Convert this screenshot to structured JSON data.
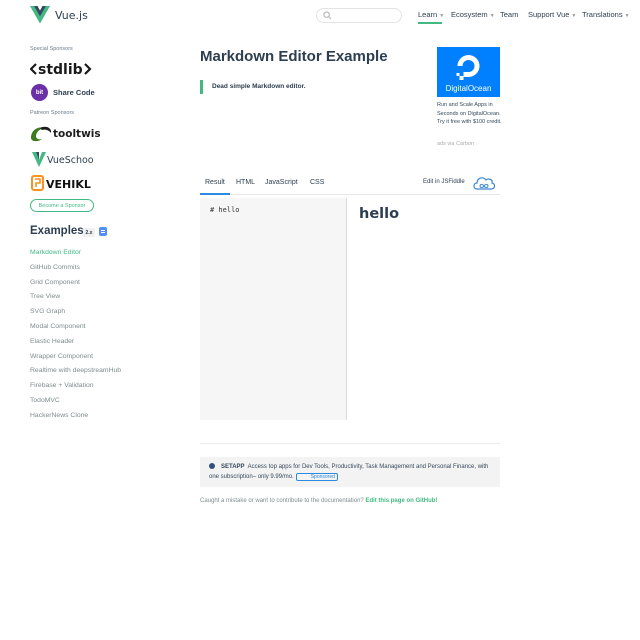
{
  "header": {
    "logo_text": "Vue.js",
    "search_placeholder": "",
    "nav": {
      "learn": "Learn",
      "ecosystem": "Ecosystem",
      "team": "Team",
      "support": "Support Vue",
      "translations": "Translations"
    }
  },
  "sidebar": {
    "special_sponsors_label": "Special Sponsors",
    "patreon_sponsors_label": "Patreon Sponsors",
    "sponsors": {
      "bit_badge": "bit",
      "share_code": "Share Code"
    },
    "become_sponsor": "Become a Sponsor",
    "examples_title": "Examples",
    "version_badge": "2.x",
    "examples": [
      "Markdown Editor",
      "GitHub Commits",
      "Grid Component",
      "Tree View",
      "SVG Graph",
      "Modal Component",
      "Elastic Header",
      "Wrapper Component",
      "Realtime with deepstreamHub",
      "Firebase + Validation",
      "TodoMVC",
      "HackerNews Clone"
    ],
    "active_example": "Markdown Editor"
  },
  "main": {
    "title": "Markdown Editor Example",
    "tip": "Dead simple Markdown editor.",
    "tabs": [
      "Result",
      "HTML",
      "JavaScript",
      "CSS"
    ],
    "active_tab": "Result",
    "jsfiddle_link": "Edit in JSFiddle",
    "editor_content": "# hello",
    "preview_heading": "hello"
  },
  "ad": {
    "brand": "DigitalOcean",
    "text": "Run and Scale Apps in Seconds on DigitalOcean. Try it free with $100 credit.",
    "via": "ads via Carbon"
  },
  "footer": {
    "setapp_name": "SETAPP",
    "setapp_text": "Access top apps for Dev Tools, Productivity, Task Management and Personal Finance, with one subscription– only 9.99/mo.",
    "sponsored": "Sponsored",
    "caught_text": "Caught a mistake or want to contribute to the documentation?",
    "edit_link": "Edit this page on GitHub!"
  },
  "colors": {
    "accent": "#42b983",
    "text": "#2c3e50",
    "digitalocean": "#0080ff",
    "tab_active": "#2c8be0"
  }
}
